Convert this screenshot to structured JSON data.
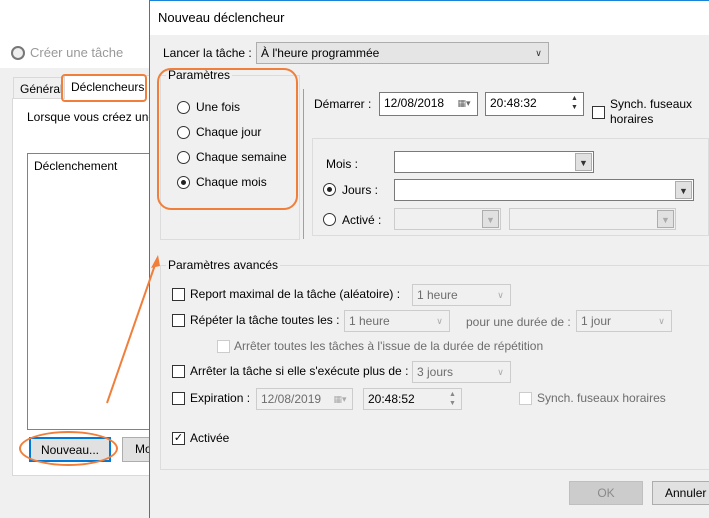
{
  "back_window": {
    "title": "Créer une tâche",
    "tabs": [
      "Général",
      "Déclencheurs"
    ],
    "intro": "Lorsque vous créez une",
    "list_header": "Déclenchement",
    "new_button": "Nouveau...",
    "modify_button": "Mo"
  },
  "dialog": {
    "title": "Nouveau déclencheur",
    "launch_label": "Lancer la tâche :",
    "launch_value": "À l'heure programmée",
    "settings": {
      "title": "Paramètres",
      "options": [
        "Une fois",
        "Chaque jour",
        "Chaque semaine",
        "Chaque mois"
      ],
      "selected": "Chaque mois"
    },
    "start": {
      "label": "Démarrer :",
      "date": "12/08/2018",
      "time": "20:48:32",
      "sync_line1": "Synch. fuseaux",
      "sync_line2": "horaires"
    },
    "monthly": {
      "months_label": "Mois :",
      "days_label": "Jours :",
      "on_label": "Activé :",
      "selected": "Jours"
    },
    "advanced": {
      "title": "Paramètres avancés",
      "delay_label": "Report maximal de la tâche (aléatoire) :",
      "delay_value": "1 heure",
      "repeat_label": "Répéter la tâche toutes les :",
      "repeat_value": "1 heure",
      "duration_label": "pour une durée de :",
      "duration_value": "1 jour",
      "stop_all_label": "Arrêter toutes les tâches à l'issue de la durée de répétition",
      "stop_label": "Arrêter la tâche si elle s'exécute plus de :",
      "stop_value": "3 jours",
      "expire_label": "Expiration :",
      "expire_date": "12/08/2019",
      "expire_time": "20:48:52",
      "expire_sync": "Synch. fuseaux horaires",
      "enabled_label": "Activée",
      "enabled": true
    },
    "ok": "OK",
    "cancel": "Annuler"
  },
  "colors": {
    "highlight": "#f07f3c",
    "accent": "#1883d7"
  }
}
